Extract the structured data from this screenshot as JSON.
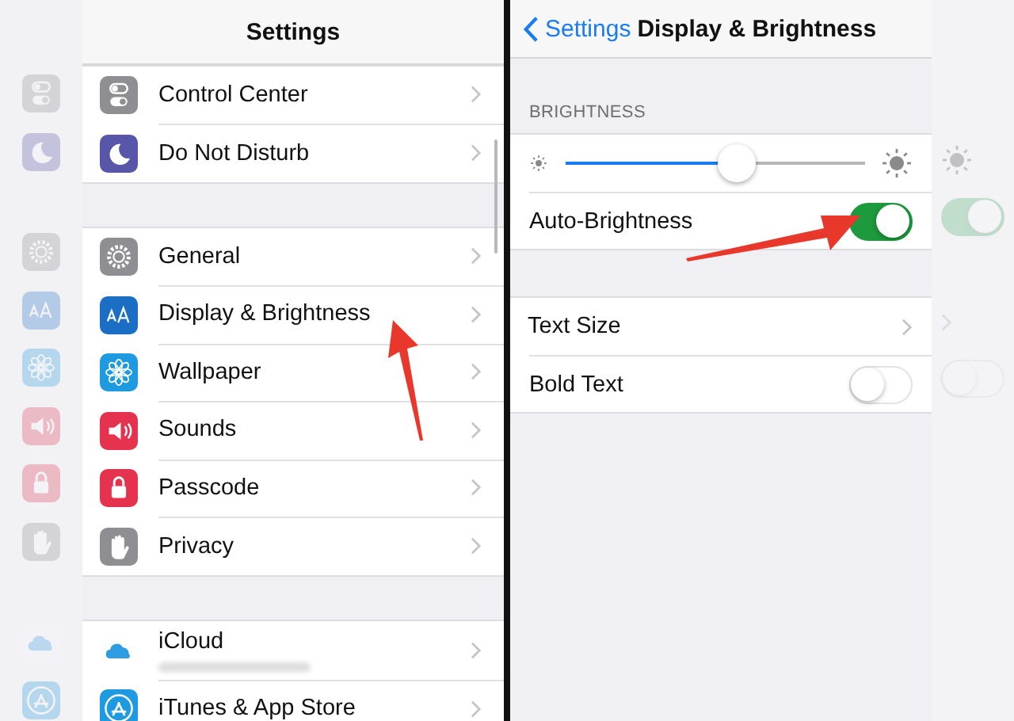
{
  "left_panel": {
    "title": "Settings",
    "groups": [
      [
        {
          "label": "Control Center",
          "kind": "switches",
          "color": "#8e8e93"
        },
        {
          "label": "Do Not Disturb",
          "kind": "moon",
          "color": "#5856a8"
        }
      ],
      [
        {
          "label": "General",
          "kind": "gear",
          "color": "#8e8e93"
        },
        {
          "label": "Display & Brightness",
          "kind": "letters",
          "color": "#1a6fc4"
        },
        {
          "label": "Wallpaper",
          "kind": "flower",
          "color": "#1e9be0"
        },
        {
          "label": "Sounds",
          "kind": "speaker",
          "color": "#e5334f"
        },
        {
          "label": "Passcode",
          "kind": "lock",
          "color": "#e5334f"
        },
        {
          "label": "Privacy",
          "kind": "hand",
          "color": "#8e8e93"
        }
      ],
      [
        {
          "label": "iCloud",
          "kind": "cloud",
          "color": "#2f9be0",
          "redacted_subtitle": true
        },
        {
          "label": "iTunes & App Store",
          "kind": "appstore",
          "color": "#1e9be0"
        }
      ]
    ]
  },
  "right_panel": {
    "back": "Settings",
    "title": "Display & Brightness",
    "section": "BRIGHTNESS",
    "slider": {
      "level": 0.57
    },
    "groups": [
      [
        {
          "kind": "toggle",
          "label": "Auto-Brightness",
          "on": true
        }
      ],
      [
        {
          "kind": "link",
          "label": "Text Size"
        },
        {
          "kind": "toggle",
          "label": "Bold Text",
          "on": false
        }
      ]
    ]
  }
}
